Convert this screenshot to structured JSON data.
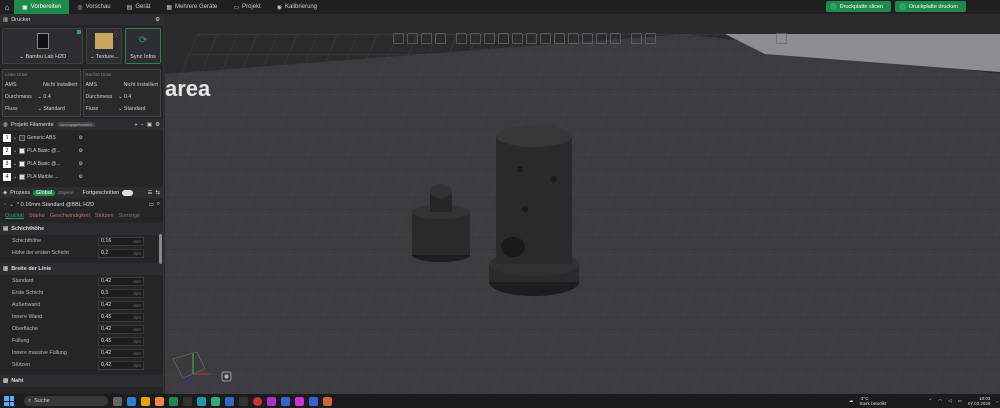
{
  "topbar": {
    "tabs": [
      {
        "label": "Vorbereiten",
        "icon": "prepare-icon"
      },
      {
        "label": "Vorschau",
        "icon": "preview-icon"
      },
      {
        "label": "Gerät",
        "icon": "device-icon"
      },
      {
        "label": "Mehrere Geräte",
        "icon": "multi-device-icon"
      },
      {
        "label": "Projekt",
        "icon": "project-icon"
      },
      {
        "label": "Kalibrierung",
        "icon": "calibration-icon"
      }
    ],
    "slice_label": "Druckplatte slicen",
    "print_label": "Druckplatte drucken"
  },
  "printer": {
    "section_title": "Drucker",
    "printer_name": "Bambu Lab H2D",
    "plate_name": "Texture...",
    "sync_label": "Sync Infos"
  },
  "nozzles": {
    "left": {
      "title": "Linke Düse",
      "ams_label": "AMS",
      "ams_value": "Nicht installiert",
      "diameter_label": "Durchmess",
      "diameter_value": "0.4",
      "flow_label": "Fluss",
      "flow_value": "Standard"
    },
    "right": {
      "title": "Rechte Düse",
      "ams_label": "AMS",
      "ams_value": "Nicht installiert",
      "diameter_label": "Durchmess",
      "diameter_value": "0.4",
      "flow_label": "Fluss",
      "flow_value": "Standard"
    }
  },
  "filaments": {
    "section_title": "Projekt Filamente",
    "badge": "Vorzugsgebunden",
    "items": [
      {
        "num": "1",
        "name": "Generic ABS",
        "color": "#3a3a3a"
      },
      {
        "num": "2",
        "name": "PLA Basic @...",
        "color": "#e8e8e8"
      },
      {
        "num": "3",
        "name": "PLA Basic @...",
        "color": "#e8e8e8"
      },
      {
        "num": "4",
        "name": "PLA Marble ...",
        "color": "#d8d8d8"
      }
    ]
  },
  "process": {
    "section_title": "Prozess",
    "global": "Global",
    "object": "Objekte",
    "advanced": "Fortgeschritten",
    "profile": "* 0.16mm Standard @BBL H2D",
    "tabs": [
      "Qualität",
      "Stärke",
      "Geschwindigkeit",
      "Stützen",
      "Sonstige"
    ],
    "groups": [
      {
        "title": "Schichthöhe",
        "rows": [
          {
            "label": "Schichthöhe",
            "value": "0,16",
            "unit": "mm"
          },
          {
            "label": "Höhe der ersten Schicht",
            "value": "0,2",
            "unit": "mm"
          }
        ]
      },
      {
        "title": "Breite der Linie",
        "rows": [
          {
            "label": "Standard",
            "value": "0,42",
            "unit": "mm"
          },
          {
            "label": "Erste Schicht",
            "value": "0,5",
            "unit": "mm"
          },
          {
            "label": "Außenwand",
            "value": "0,42",
            "unit": "mm"
          },
          {
            "label": "Innere Wand",
            "value": "0,45",
            "unit": "mm"
          },
          {
            "label": "Oberfläche",
            "value": "0,42",
            "unit": "mm"
          },
          {
            "label": "Füllung",
            "value": "0,45",
            "unit": "mm"
          },
          {
            "label": "Innere massive Füllung",
            "value": "0,42",
            "unit": "mm"
          },
          {
            "label": "Stützen",
            "value": "0,42",
            "unit": "mm"
          }
        ]
      },
      {
        "title": "Naht",
        "rows": []
      }
    ]
  },
  "viewport": {
    "bed_text": "area"
  },
  "taskbar": {
    "search_label": "Suche",
    "weather_temp": "-3°C",
    "weather_text": "Stark bewölkt",
    "time": "18:03",
    "date": "07.03.2026"
  }
}
